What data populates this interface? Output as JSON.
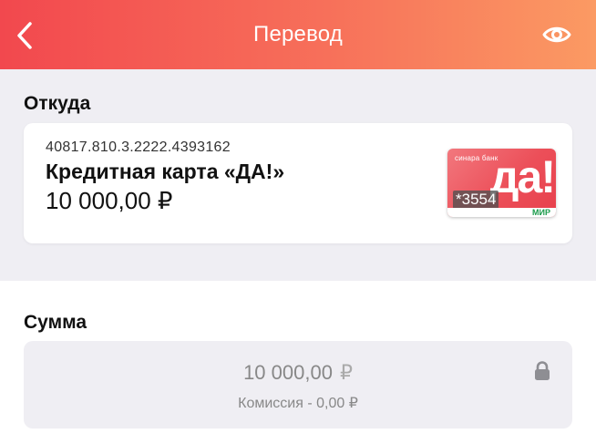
{
  "header": {
    "title": "Перевод",
    "gradient_start": "#f2484e",
    "gradient_end": "#fb9a63",
    "back_icon": "chevron-left-icon",
    "visibility_icon": "eye-icon"
  },
  "from": {
    "section_title": "Откуда",
    "account_number": "40817.810.3.2222.4393162",
    "card_name": "Кредитная карта «ДА!»",
    "balance": "10 000,00 ₽",
    "card_image": {
      "bank_label": "синара банк",
      "brand_text": "да!",
      "last_digits": "*3554",
      "payment_system": "МИР"
    }
  },
  "sum": {
    "section_title": "Сумма",
    "amount": "10 000,00",
    "currency": "₽",
    "commission": "Комиссия - 0,00 ₽",
    "lock_icon": "lock-icon"
  }
}
